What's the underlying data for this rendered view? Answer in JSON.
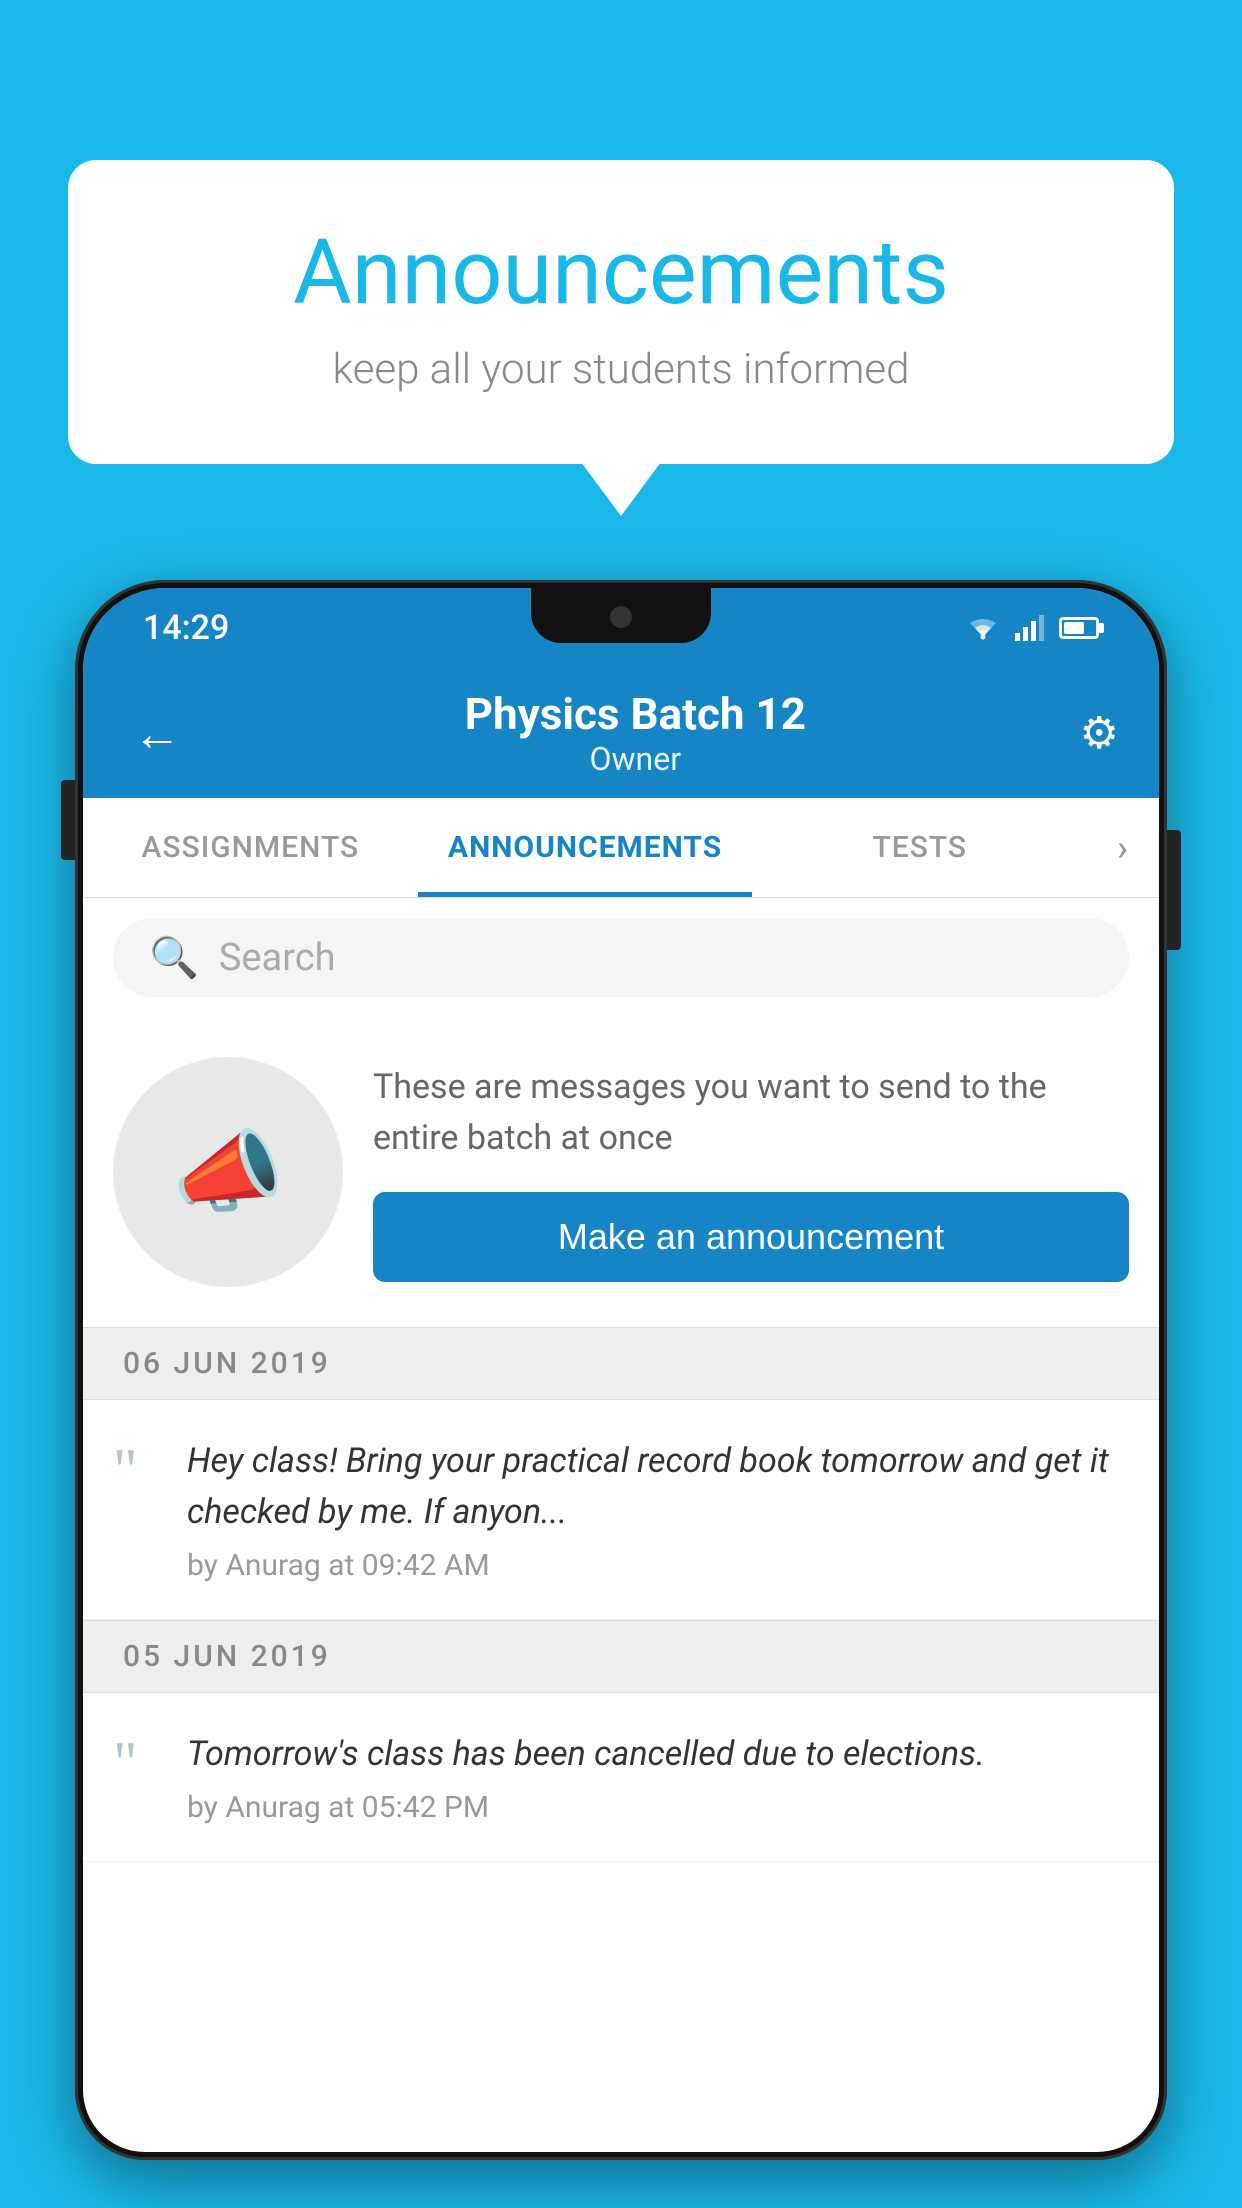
{
  "background_color": "#1ab8e8",
  "speech_bubble": {
    "title": "Announcements",
    "subtitle": "keep all your students informed"
  },
  "phone": {
    "status_bar": {
      "time": "14:29"
    },
    "header": {
      "title": "Physics Batch 12",
      "subtitle": "Owner",
      "back_label": "←",
      "settings_label": "⚙"
    },
    "tabs": [
      {
        "label": "ASSIGNMENTS",
        "active": false
      },
      {
        "label": "ANNOUNCEMENTS",
        "active": true
      },
      {
        "label": "TESTS",
        "active": false
      }
    ],
    "search": {
      "placeholder": "Search"
    },
    "promo": {
      "description": "These are messages you want to send to the entire batch at once",
      "button_label": "Make an announcement"
    },
    "announcements": [
      {
        "date": "06  JUN  2019",
        "text": "Hey class! Bring your practical record book tomorrow and get it checked by me. If anyon...",
        "meta": "by Anurag at 09:42 AM"
      },
      {
        "date": "05  JUN  2019",
        "text": "Tomorrow's class has been cancelled due to elections.",
        "meta": "by Anurag at 05:42 PM"
      }
    ]
  }
}
